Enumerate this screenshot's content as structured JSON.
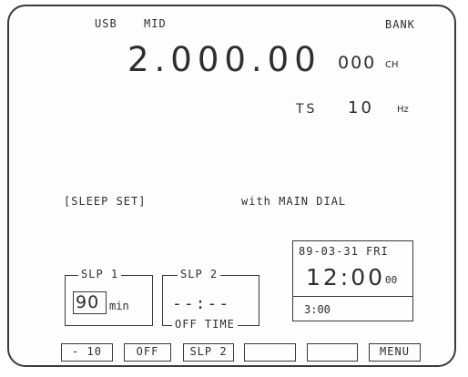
{
  "mode": "USB",
  "vfo": "MID",
  "bank": "BANK",
  "frequency": "2.000.00",
  "channel": {
    "number": "000",
    "unit": "CH"
  },
  "tuning_step": {
    "label": "TS",
    "value": "10",
    "unit": "Hz"
  },
  "message": {
    "title": "[SLEEP SET]",
    "hint": "with MAIN DIAL"
  },
  "clock": {
    "date": "89-03-31 FRI",
    "time": "12:00",
    "seconds": "00",
    "sleep_time": "3:00"
  },
  "slp1": {
    "label": "SLP 1",
    "value": "90",
    "unit": "min"
  },
  "slp2": {
    "label": "SLP 2",
    "value": "--:--",
    "sublabel": "OFF TIME"
  },
  "softkeys": [
    "- 10",
    "OFF",
    "SLP 2",
    "",
    "",
    "MENU"
  ]
}
